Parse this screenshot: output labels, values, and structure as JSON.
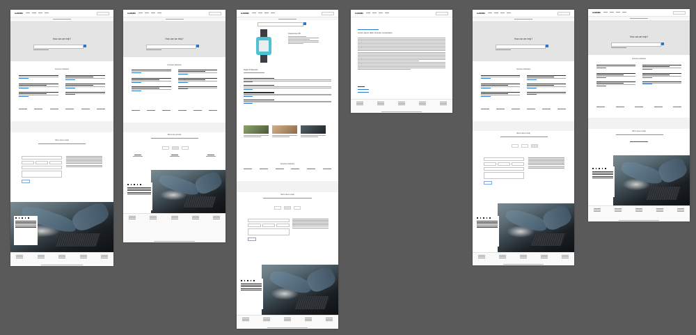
{
  "board": {
    "background_color": "#5a5a5a",
    "accent_color": "#2a76c8",
    "artboards": [
      {
        "id": "support-home-chat",
        "hero_title": "How can we help?",
        "section_title": "Common Solutions",
        "contact_title": "We're here to help"
      },
      {
        "id": "support-home-phone",
        "hero_title": "How can we help?",
        "section_title": "Common Solutions",
        "contact_title": "We're here to help"
      },
      {
        "id": "product-search-results",
        "hero_title": "",
        "section_title": "Common Solutions",
        "contact_title": "We're here to help",
        "results_title": "Search Results"
      },
      {
        "id": "solution-article",
        "article_title": "Lorem ipsum dolor sit amet, consectetur"
      },
      {
        "id": "support-home-email",
        "hero_title": "How can we help?",
        "section_title": "Common Solutions",
        "contact_title": "We're here to help"
      },
      {
        "id": "support-home-compact",
        "hero_title": "How can we help?",
        "section_title": "Common Solutions",
        "contact_title": "We're here to help"
      }
    ]
  },
  "product_label": "Forerunner 35",
  "brand_name": "GARMIN"
}
